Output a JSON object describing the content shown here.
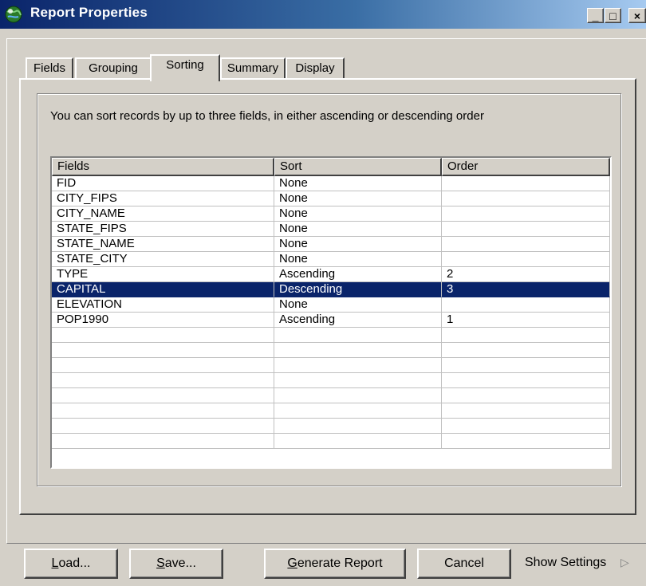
{
  "window": {
    "title": "Report Properties",
    "controls": {
      "minimize": "_",
      "maximize": "□",
      "close": "×"
    }
  },
  "tabs": [
    {
      "label": "Fields",
      "active": false
    },
    {
      "label": "Grouping",
      "active": false
    },
    {
      "label": "Sorting",
      "active": true
    },
    {
      "label": "Summary",
      "active": false
    },
    {
      "label": "Display",
      "active": false
    }
  ],
  "sorting": {
    "description": "You can sort records by up to three fields, in either ascending or descending order",
    "columns": [
      "Fields",
      "Sort",
      "Order"
    ],
    "rows": [
      {
        "field": "FID",
        "sort": "None",
        "order": ""
      },
      {
        "field": "CITY_FIPS",
        "sort": "None",
        "order": ""
      },
      {
        "field": "CITY_NAME",
        "sort": "None",
        "order": ""
      },
      {
        "field": "STATE_FIPS",
        "sort": "None",
        "order": ""
      },
      {
        "field": "STATE_NAME",
        "sort": "None",
        "order": ""
      },
      {
        "field": "STATE_CITY",
        "sort": "None",
        "order": ""
      },
      {
        "field": "TYPE",
        "sort": "Ascending",
        "order": "2"
      },
      {
        "field": "CAPITAL",
        "sort": "Descending",
        "order": "3",
        "selected": true
      },
      {
        "field": "ELEVATION",
        "sort": "None",
        "order": ""
      },
      {
        "field": "POP1990",
        "sort": "Ascending",
        "order": "1"
      }
    ]
  },
  "buttons": {
    "load": {
      "mnemonic": "L",
      "rest": "oad..."
    },
    "save": {
      "mnemonic": "S",
      "rest": "ave..."
    },
    "generate": {
      "mnemonic": "G",
      "rest": "enerate Report"
    },
    "cancel": "Cancel"
  },
  "show_settings": "Show Settings",
  "colors": {
    "selection": "#0a246a",
    "face": "#d4d0c8",
    "title_start": "#0a246a"
  },
  "icons": {
    "app": "globe-icon",
    "expand": "triangle-right-icon"
  }
}
